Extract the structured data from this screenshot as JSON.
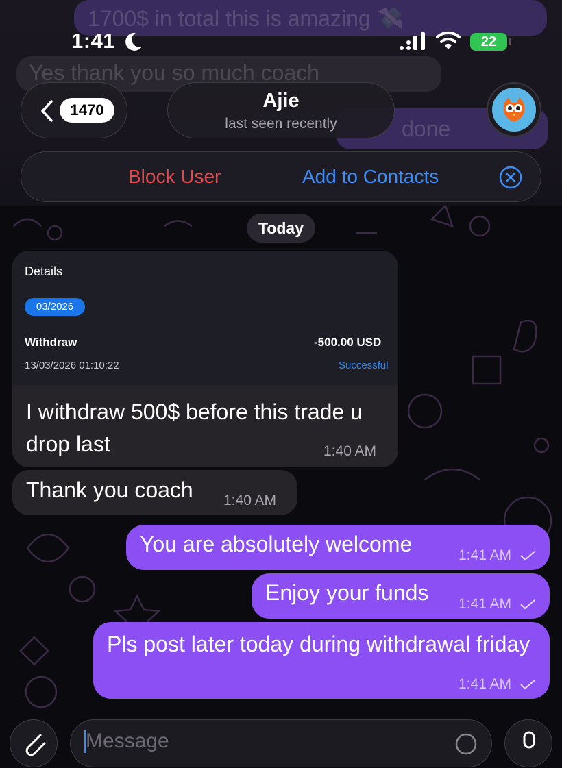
{
  "background_ghosts": {
    "msg1": "1700$ in total this is amazing 💸",
    "msg2": "Yes thank you so much coach",
    "msg3": "done"
  },
  "status_bar": {
    "time": "1:41",
    "battery": "22"
  },
  "header": {
    "back_count": "1470",
    "contact_name": "Ajie",
    "contact_status": "last seen recently"
  },
  "action_bar": {
    "block_label": "Block User",
    "add_label": "Add to Contacts"
  },
  "date_separator": "Today",
  "messages": {
    "card": {
      "title": "Details",
      "period": "03/2026",
      "type": "Withdraw",
      "amount": "-500.00 USD",
      "timestamp": "13/03/2026 01:10:22",
      "status": "Successful",
      "text": "I withdraw 500$ before this trade u drop last",
      "time": "1:40 AM"
    },
    "incoming2": {
      "text": "Thank you coach",
      "time": "1:40 AM"
    },
    "out1": {
      "text": "You are absolutely welcome",
      "time": "1:41 AM"
    },
    "out2": {
      "text": "Enjoy your funds",
      "time": "1:41 AM"
    },
    "out3": {
      "text": "Pls post later today during withdrawal friday",
      "time": "1:41 AM"
    }
  },
  "composer": {
    "placeholder": "Message"
  },
  "colors": {
    "outgoing_bubble": "#8b4ff3",
    "incoming_bubble": "#262329",
    "block_red": "#e5484d",
    "link_blue": "#3d8bf5"
  }
}
